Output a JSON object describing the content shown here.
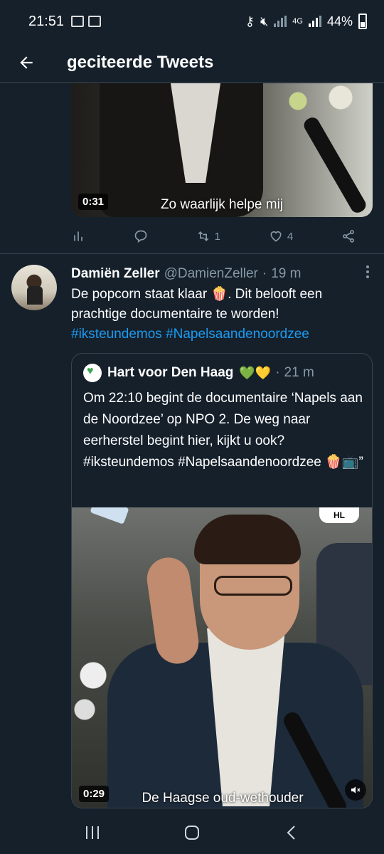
{
  "status_bar": {
    "time": "21:51",
    "network": "4G",
    "battery": "44%",
    "icons": [
      "image-icon",
      "calendar-icon",
      "key-icon",
      "mute-icon",
      "wifi-icon",
      "signal-icon",
      "battery-icon"
    ]
  },
  "header": {
    "title": "geciteerde Tweets",
    "back_icon": "arrow-left-icon"
  },
  "tweet1": {
    "media": {
      "duration": "0:31",
      "subtitle": "Zo waarlijk helpe mij"
    },
    "actions": {
      "analytics_icon": "analytics-icon",
      "reply_icon": "reply-icon",
      "retweet_count": "1",
      "like_count": "4",
      "share_icon": "share-icon"
    }
  },
  "tweet2": {
    "name": "Damiën Zeller",
    "handle": "@DamienZeller",
    "time": "19 m",
    "text_before": "De popcorn staat klaar 🍿. Dit belooft een prachtige documentaire te worden!",
    "hashtag1": "#iksteundemos",
    "hashtag2": "#Napelsaandenoordzee",
    "quoted": {
      "name": "Hart voor Den Haag",
      "emoji": "💚💛",
      "time": "21 m",
      "text": "Om 22:10 begint de documentaire ‘Napels aan de Noordzee’ op NPO 2. De weg naar eerherstel begint hier, kijkt u ook? #iksteundemos #Napelsaandenoordzee 🍿📺”",
      "media": {
        "duration": "0:29",
        "subtitle": "De Haagse oud-wethouder",
        "badge": "HL"
      }
    }
  },
  "colors": {
    "background": "#15202b",
    "accent": "#1d9bf0",
    "muted": "#8899a6",
    "border": "#38444d"
  }
}
